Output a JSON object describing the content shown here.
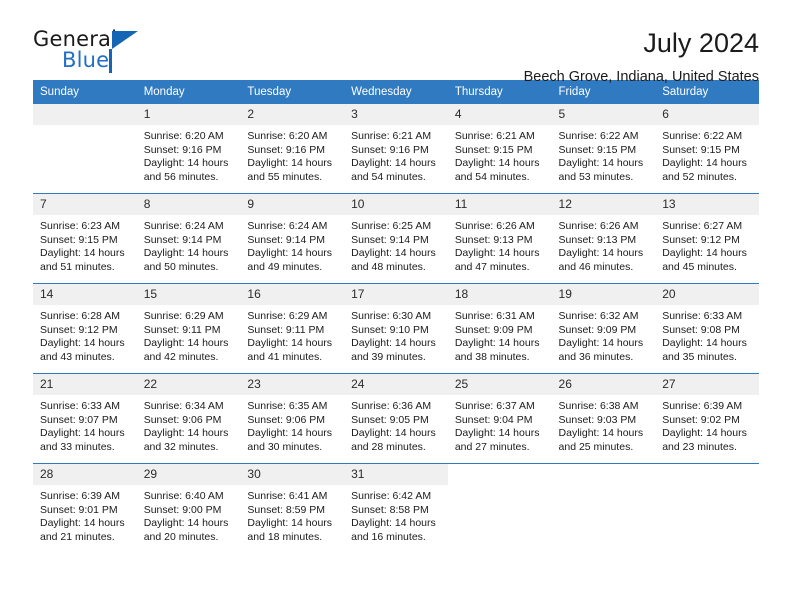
{
  "brand": {
    "word1": "General",
    "word2": "Blue",
    "accent_color": "#1565b5"
  },
  "header": {
    "title": "July 2024",
    "subtitle": "Beech Grove, Indiana, United States",
    "header_bg": "#2f7ac0",
    "daynum_bg": "#f0f0f0"
  },
  "weekday_headers": [
    "Sunday",
    "Monday",
    "Tuesday",
    "Wednesday",
    "Thursday",
    "Friday",
    "Saturday"
  ],
  "weeks": [
    [
      {
        "day": "",
        "sunrise": "",
        "sunset": "",
        "daylight_line1": "",
        "daylight_line2": "",
        "empty": true
      },
      {
        "day": "1",
        "sunrise": "Sunrise: 6:20 AM",
        "sunset": "Sunset: 9:16 PM",
        "daylight_line1": "Daylight: 14 hours",
        "daylight_line2": "and 56 minutes."
      },
      {
        "day": "2",
        "sunrise": "Sunrise: 6:20 AM",
        "sunset": "Sunset: 9:16 PM",
        "daylight_line1": "Daylight: 14 hours",
        "daylight_line2": "and 55 minutes."
      },
      {
        "day": "3",
        "sunrise": "Sunrise: 6:21 AM",
        "sunset": "Sunset: 9:16 PM",
        "daylight_line1": "Daylight: 14 hours",
        "daylight_line2": "and 54 minutes."
      },
      {
        "day": "4",
        "sunrise": "Sunrise: 6:21 AM",
        "sunset": "Sunset: 9:15 PM",
        "daylight_line1": "Daylight: 14 hours",
        "daylight_line2": "and 54 minutes."
      },
      {
        "day": "5",
        "sunrise": "Sunrise: 6:22 AM",
        "sunset": "Sunset: 9:15 PM",
        "daylight_line1": "Daylight: 14 hours",
        "daylight_line2": "and 53 minutes."
      },
      {
        "day": "6",
        "sunrise": "Sunrise: 6:22 AM",
        "sunset": "Sunset: 9:15 PM",
        "daylight_line1": "Daylight: 14 hours",
        "daylight_line2": "and 52 minutes."
      }
    ],
    [
      {
        "day": "7",
        "sunrise": "Sunrise: 6:23 AM",
        "sunset": "Sunset: 9:15 PM",
        "daylight_line1": "Daylight: 14 hours",
        "daylight_line2": "and 51 minutes."
      },
      {
        "day": "8",
        "sunrise": "Sunrise: 6:24 AM",
        "sunset": "Sunset: 9:14 PM",
        "daylight_line1": "Daylight: 14 hours",
        "daylight_line2": "and 50 minutes."
      },
      {
        "day": "9",
        "sunrise": "Sunrise: 6:24 AM",
        "sunset": "Sunset: 9:14 PM",
        "daylight_line1": "Daylight: 14 hours",
        "daylight_line2": "and 49 minutes."
      },
      {
        "day": "10",
        "sunrise": "Sunrise: 6:25 AM",
        "sunset": "Sunset: 9:14 PM",
        "daylight_line1": "Daylight: 14 hours",
        "daylight_line2": "and 48 minutes."
      },
      {
        "day": "11",
        "sunrise": "Sunrise: 6:26 AM",
        "sunset": "Sunset: 9:13 PM",
        "daylight_line1": "Daylight: 14 hours",
        "daylight_line2": "and 47 minutes."
      },
      {
        "day": "12",
        "sunrise": "Sunrise: 6:26 AM",
        "sunset": "Sunset: 9:13 PM",
        "daylight_line1": "Daylight: 14 hours",
        "daylight_line2": "and 46 minutes."
      },
      {
        "day": "13",
        "sunrise": "Sunrise: 6:27 AM",
        "sunset": "Sunset: 9:12 PM",
        "daylight_line1": "Daylight: 14 hours",
        "daylight_line2": "and 45 minutes."
      }
    ],
    [
      {
        "day": "14",
        "sunrise": "Sunrise: 6:28 AM",
        "sunset": "Sunset: 9:12 PM",
        "daylight_line1": "Daylight: 14 hours",
        "daylight_line2": "and 43 minutes."
      },
      {
        "day": "15",
        "sunrise": "Sunrise: 6:29 AM",
        "sunset": "Sunset: 9:11 PM",
        "daylight_line1": "Daylight: 14 hours",
        "daylight_line2": "and 42 minutes."
      },
      {
        "day": "16",
        "sunrise": "Sunrise: 6:29 AM",
        "sunset": "Sunset: 9:11 PM",
        "daylight_line1": "Daylight: 14 hours",
        "daylight_line2": "and 41 minutes."
      },
      {
        "day": "17",
        "sunrise": "Sunrise: 6:30 AM",
        "sunset": "Sunset: 9:10 PM",
        "daylight_line1": "Daylight: 14 hours",
        "daylight_line2": "and 39 minutes."
      },
      {
        "day": "18",
        "sunrise": "Sunrise: 6:31 AM",
        "sunset": "Sunset: 9:09 PM",
        "daylight_line1": "Daylight: 14 hours",
        "daylight_line2": "and 38 minutes."
      },
      {
        "day": "19",
        "sunrise": "Sunrise: 6:32 AM",
        "sunset": "Sunset: 9:09 PM",
        "daylight_line1": "Daylight: 14 hours",
        "daylight_line2": "and 36 minutes."
      },
      {
        "day": "20",
        "sunrise": "Sunrise: 6:33 AM",
        "sunset": "Sunset: 9:08 PM",
        "daylight_line1": "Daylight: 14 hours",
        "daylight_line2": "and 35 minutes."
      }
    ],
    [
      {
        "day": "21",
        "sunrise": "Sunrise: 6:33 AM",
        "sunset": "Sunset: 9:07 PM",
        "daylight_line1": "Daylight: 14 hours",
        "daylight_line2": "and 33 minutes."
      },
      {
        "day": "22",
        "sunrise": "Sunrise: 6:34 AM",
        "sunset": "Sunset: 9:06 PM",
        "daylight_line1": "Daylight: 14 hours",
        "daylight_line2": "and 32 minutes."
      },
      {
        "day": "23",
        "sunrise": "Sunrise: 6:35 AM",
        "sunset": "Sunset: 9:06 PM",
        "daylight_line1": "Daylight: 14 hours",
        "daylight_line2": "and 30 minutes."
      },
      {
        "day": "24",
        "sunrise": "Sunrise: 6:36 AM",
        "sunset": "Sunset: 9:05 PM",
        "daylight_line1": "Daylight: 14 hours",
        "daylight_line2": "and 28 minutes."
      },
      {
        "day": "25",
        "sunrise": "Sunrise: 6:37 AM",
        "sunset": "Sunset: 9:04 PM",
        "daylight_line1": "Daylight: 14 hours",
        "daylight_line2": "and 27 minutes."
      },
      {
        "day": "26",
        "sunrise": "Sunrise: 6:38 AM",
        "sunset": "Sunset: 9:03 PM",
        "daylight_line1": "Daylight: 14 hours",
        "daylight_line2": "and 25 minutes."
      },
      {
        "day": "27",
        "sunrise": "Sunrise: 6:39 AM",
        "sunset": "Sunset: 9:02 PM",
        "daylight_line1": "Daylight: 14 hours",
        "daylight_line2": "and 23 minutes."
      }
    ],
    [
      {
        "day": "28",
        "sunrise": "Sunrise: 6:39 AM",
        "sunset": "Sunset: 9:01 PM",
        "daylight_line1": "Daylight: 14 hours",
        "daylight_line2": "and 21 minutes."
      },
      {
        "day": "29",
        "sunrise": "Sunrise: 6:40 AM",
        "sunset": "Sunset: 9:00 PM",
        "daylight_line1": "Daylight: 14 hours",
        "daylight_line2": "and 20 minutes."
      },
      {
        "day": "30",
        "sunrise": "Sunrise: 6:41 AM",
        "sunset": "Sunset: 8:59 PM",
        "daylight_line1": "Daylight: 14 hours",
        "daylight_line2": "and 18 minutes."
      },
      {
        "day": "31",
        "sunrise": "Sunrise: 6:42 AM",
        "sunset": "Sunset: 8:58 PM",
        "daylight_line1": "Daylight: 14 hours",
        "daylight_line2": "and 16 minutes."
      },
      {
        "day": "",
        "sunrise": "",
        "sunset": "",
        "daylight_line1": "",
        "daylight_line2": "",
        "empty": true,
        "blank": true
      },
      {
        "day": "",
        "sunrise": "",
        "sunset": "",
        "daylight_line1": "",
        "daylight_line2": "",
        "empty": true,
        "blank": true
      },
      {
        "day": "",
        "sunrise": "",
        "sunset": "",
        "daylight_line1": "",
        "daylight_line2": "",
        "empty": true,
        "blank": true
      }
    ]
  ]
}
